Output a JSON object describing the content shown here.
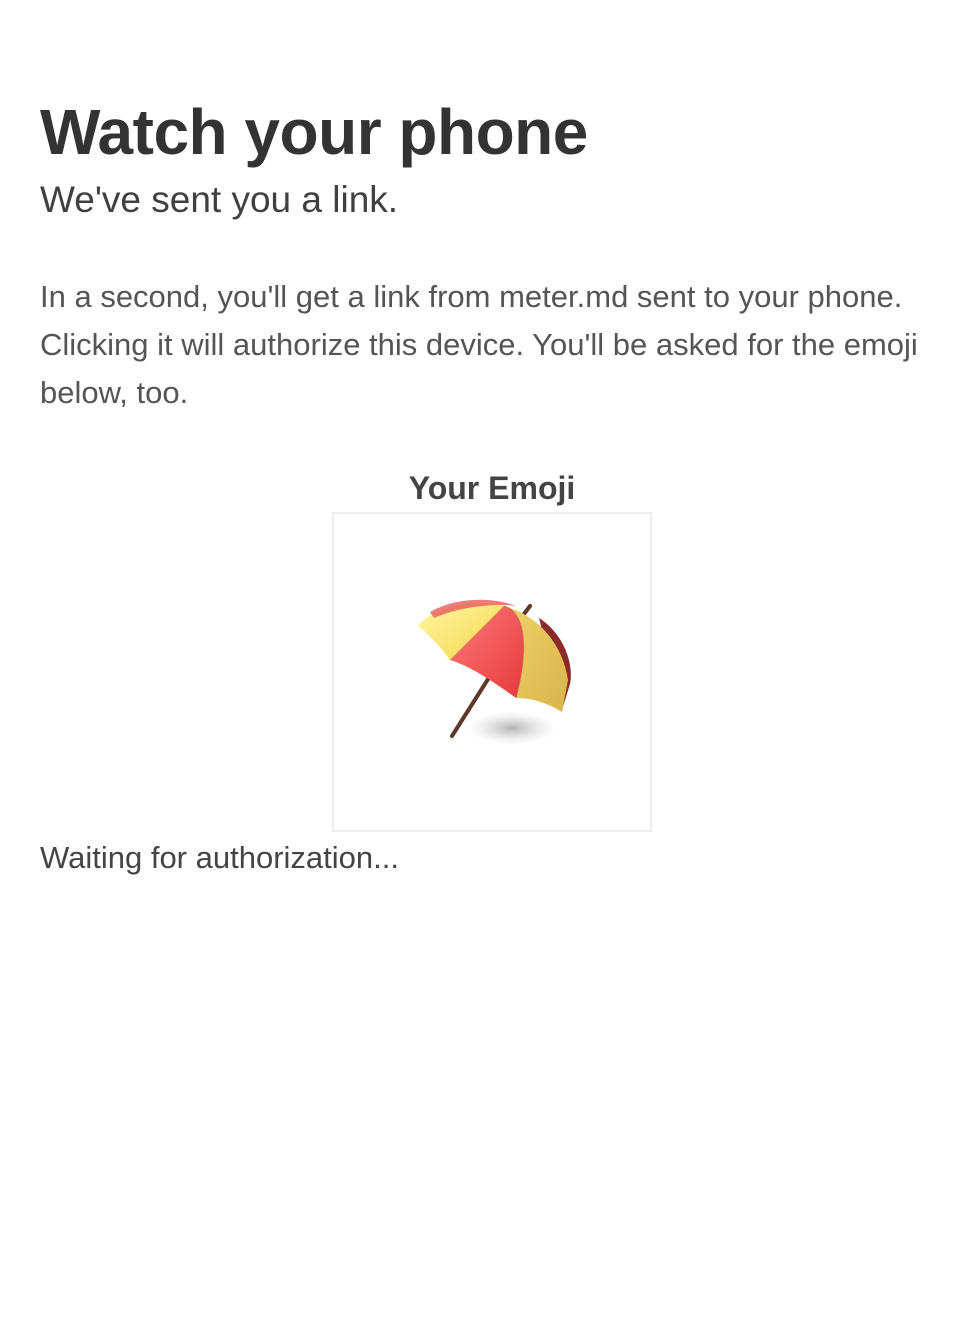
{
  "header": {
    "title": "Watch your phone",
    "subtitle": "We've sent you a link."
  },
  "main": {
    "instructions": "In a second, you'll get a link from meter.md sent to your phone. Clicking it will authorize this device. You'll be asked for the emoji below, too.",
    "emoji": {
      "label": "Your Emoji",
      "icon": "umbrella-on-ground-icon"
    },
    "status": "Waiting for authorization..."
  },
  "colors": {
    "text_dark": "#333333",
    "text_body": "#555555",
    "umbrella_red": "#f05050",
    "umbrella_yellow": "#f5e06a",
    "umbrella_pole": "#5b3a29",
    "box_border": "#eeeeee"
  }
}
